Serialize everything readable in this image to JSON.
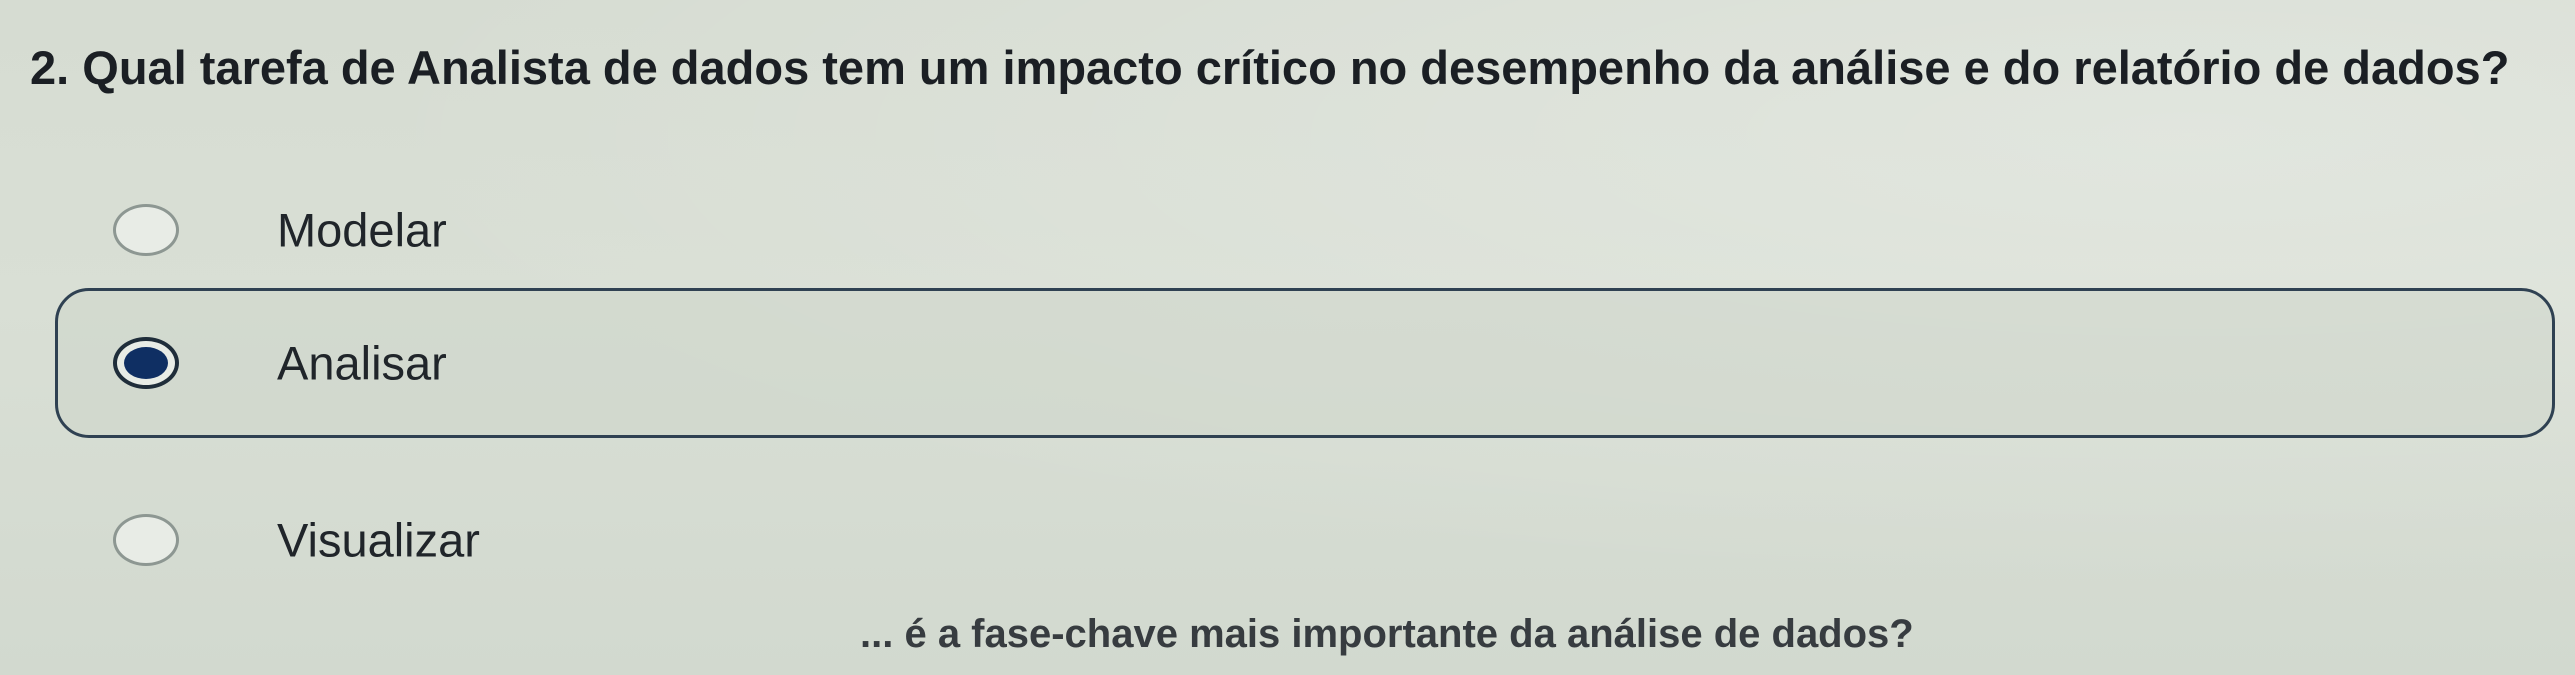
{
  "question": {
    "text": "2. Qual tarefa de Analista de dados tem um impacto crítico no desempenho da análise e do relatório de dados?"
  },
  "options": [
    {
      "label": "Modelar",
      "selected": false
    },
    {
      "label": "Analisar",
      "selected": true
    },
    {
      "label": "Visualizar",
      "selected": false
    }
  ],
  "next_question_partial": {
    "text": "... é a fase-chave mais importante da análise de dados?"
  },
  "colors": {
    "background": "#d7ddd3",
    "selected_border": "#2f4152",
    "radio_fill_selected": "#0f2f63"
  }
}
